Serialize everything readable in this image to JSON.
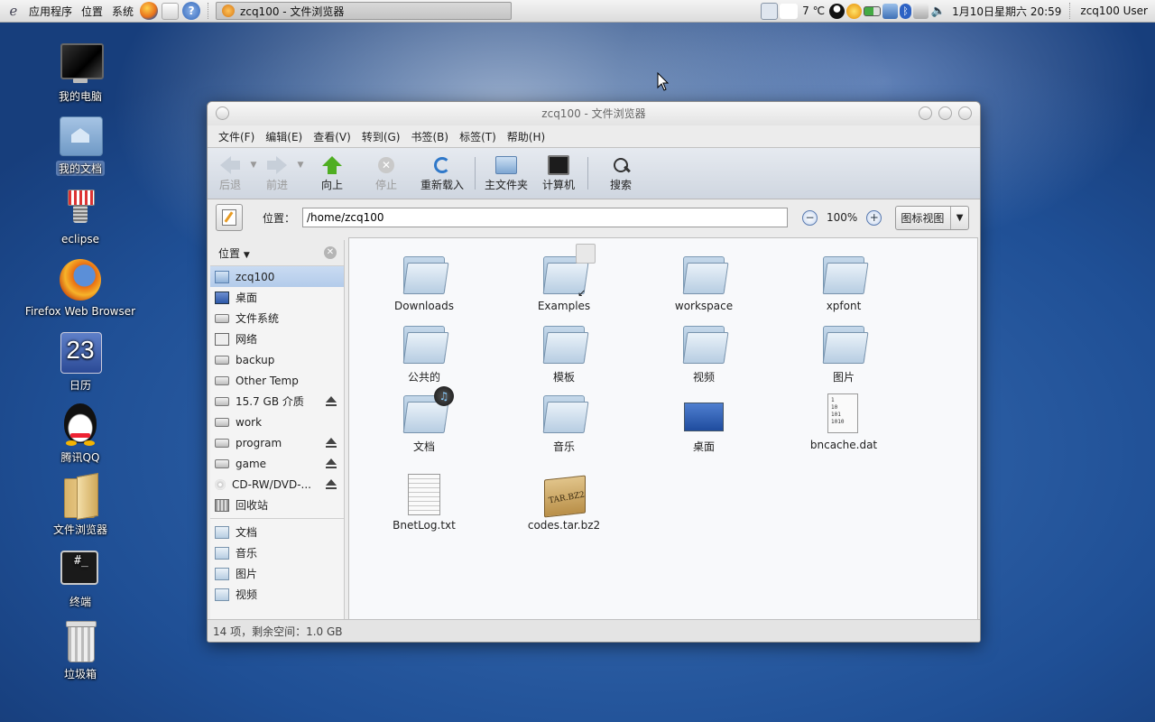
{
  "panel": {
    "menus": [
      "应用程序",
      "位置",
      "系统"
    ],
    "task_title": "zcq100 - 文件浏览器",
    "temperature": "7 ℃",
    "datetime": "1月10日星期六 20:59",
    "user": "zcq100 User"
  },
  "desktop": {
    "icons": [
      {
        "label": "我的电脑",
        "icon": "computer-icon"
      },
      {
        "label": "我的文档",
        "icon": "home-folder-icon"
      },
      {
        "label": "eclipse",
        "icon": "eclipse-icon"
      },
      {
        "label": "Firefox Web Browser",
        "icon": "firefox-icon"
      },
      {
        "label": "日历",
        "icon": "calendar-icon",
        "day": "23"
      },
      {
        "label": "腾讯QQ",
        "icon": "qq-icon"
      },
      {
        "label": "文件浏览器",
        "icon": "file-browser-icon"
      },
      {
        "label": "终端",
        "icon": "terminal-icon",
        "glyph": "#_"
      },
      {
        "label": "垃圾箱",
        "icon": "trash-icon"
      }
    ]
  },
  "window": {
    "title": "zcq100 - 文件浏览器",
    "menu": [
      "文件(F)",
      "编辑(E)",
      "查看(V)",
      "转到(G)",
      "书签(B)",
      "标签(T)",
      "帮助(H)"
    ],
    "toolbar": {
      "back": "后退",
      "forward": "前进",
      "up": "向上",
      "stop": "停止",
      "reload": "重新载入",
      "home": "主文件夹",
      "computer": "计算机",
      "search": "搜索"
    },
    "location": {
      "label": "位置：",
      "value": "/home/zcq100",
      "zoom": "100%",
      "view": "图标视图"
    },
    "sidebar": {
      "header": "位置",
      "places": [
        {
          "label": "zcq100",
          "icon": "home-icon",
          "eject": false
        },
        {
          "label": "桌面",
          "icon": "desktop-icon",
          "eject": false
        },
        {
          "label": "文件系统",
          "icon": "drive-icon",
          "eject": false
        },
        {
          "label": "网络",
          "icon": "network-icon",
          "eject": false
        },
        {
          "label": "backup",
          "icon": "drive-icon",
          "eject": false
        },
        {
          "label": "Other Temp",
          "icon": "drive-icon",
          "eject": false
        },
        {
          "label": "15.7 GB 介质",
          "icon": "drive-icon",
          "eject": true
        },
        {
          "label": "work",
          "icon": "drive-icon",
          "eject": false
        },
        {
          "label": "program",
          "icon": "drive-icon",
          "eject": true
        },
        {
          "label": "game",
          "icon": "drive-icon",
          "eject": true
        },
        {
          "label": "CD-RW/DVD-...",
          "icon": "cdrom-icon",
          "eject": true
        },
        {
          "label": "回收站",
          "icon": "trash-icon",
          "eject": false
        }
      ],
      "bookmarks": [
        "文档",
        "音乐",
        "图片",
        "视频"
      ]
    },
    "files": [
      {
        "name": "Downloads",
        "kind": "folder"
      },
      {
        "name": "Examples",
        "kind": "folder-link"
      },
      {
        "name": "workspace",
        "kind": "folder"
      },
      {
        "name": "xpfont",
        "kind": "folder"
      },
      {
        "name": "公共的",
        "kind": "folder"
      },
      {
        "name": "模板",
        "kind": "folder"
      },
      {
        "name": "视频",
        "kind": "folder"
      },
      {
        "name": "图片",
        "kind": "folder"
      },
      {
        "name": "文档",
        "kind": "folder-music"
      },
      {
        "name": "音乐",
        "kind": "folder"
      },
      {
        "name": "桌面",
        "kind": "desktop"
      },
      {
        "name": "bncache.dat",
        "kind": "binary"
      },
      {
        "name": "BnetLog.txt",
        "kind": "text"
      },
      {
        "name": "codes.tar.bz2",
        "kind": "archive"
      }
    ],
    "status": "14 项，剩余空间：1.0 GB"
  }
}
